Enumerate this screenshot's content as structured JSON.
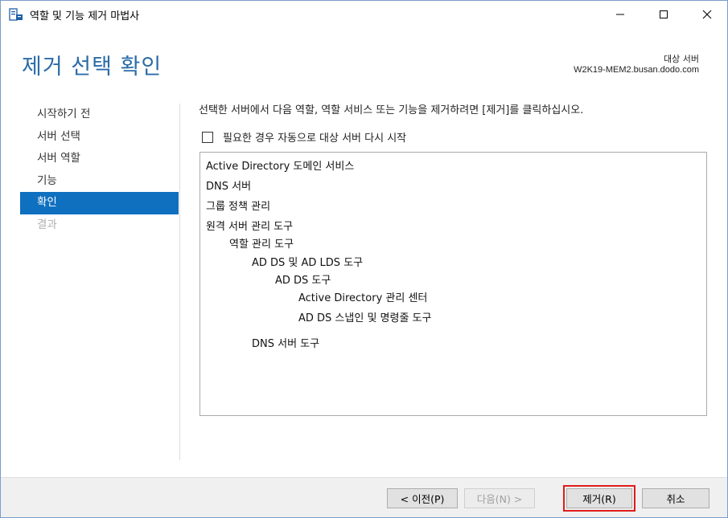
{
  "window": {
    "title": "역할 및 기능 제거 마법사"
  },
  "header": {
    "page_title": "제거 선택 확인",
    "destination_label": "대상 서버",
    "destination_server": "W2K19-MEM2.busan.dodo.com"
  },
  "nav": {
    "items": [
      {
        "label": "시작하기 전",
        "state": "normal"
      },
      {
        "label": "서버 선택",
        "state": "normal"
      },
      {
        "label": "서버 역할",
        "state": "normal"
      },
      {
        "label": "기능",
        "state": "normal"
      },
      {
        "label": "확인",
        "state": "active"
      },
      {
        "label": "결과",
        "state": "disabled"
      }
    ]
  },
  "content": {
    "instruction": "선택한 서버에서 다음 역할, 역할 서비스 또는 기능을 제거하려면 [제거]를 클릭하십시오.",
    "restart_label": "필요한 경우 자동으로 대상 서버 다시 시작",
    "restart_checked": false,
    "items": [
      {
        "label": "Active Directory 도메인 서비스",
        "level": 0
      },
      {
        "label": "DNS 서버",
        "level": 0
      },
      {
        "label": "그룹 정책 관리",
        "level": 0
      },
      {
        "label": "원격 서버 관리 도구",
        "level": 0
      },
      {
        "label": "역할 관리 도구",
        "level": 1
      },
      {
        "label": "AD DS 및 AD LDS 도구",
        "level": 2
      },
      {
        "label": "AD DS 도구",
        "level": 3
      },
      {
        "label": "Active Directory 관리 센터",
        "level": 4
      },
      {
        "label": "AD DS 스냅인 및 명령줄 도구",
        "level": 4
      },
      {
        "label": "DNS 서버 도구",
        "level": 2
      }
    ]
  },
  "footer": {
    "prev_label": "< 이전(P)",
    "next_label": "다음(N) >",
    "remove_label": "제거(R)",
    "cancel_label": "취소"
  },
  "colors": {
    "title_blue": "#2b6ca8",
    "nav_active": "#1070c0",
    "highlight_red": "#e01b1b"
  }
}
